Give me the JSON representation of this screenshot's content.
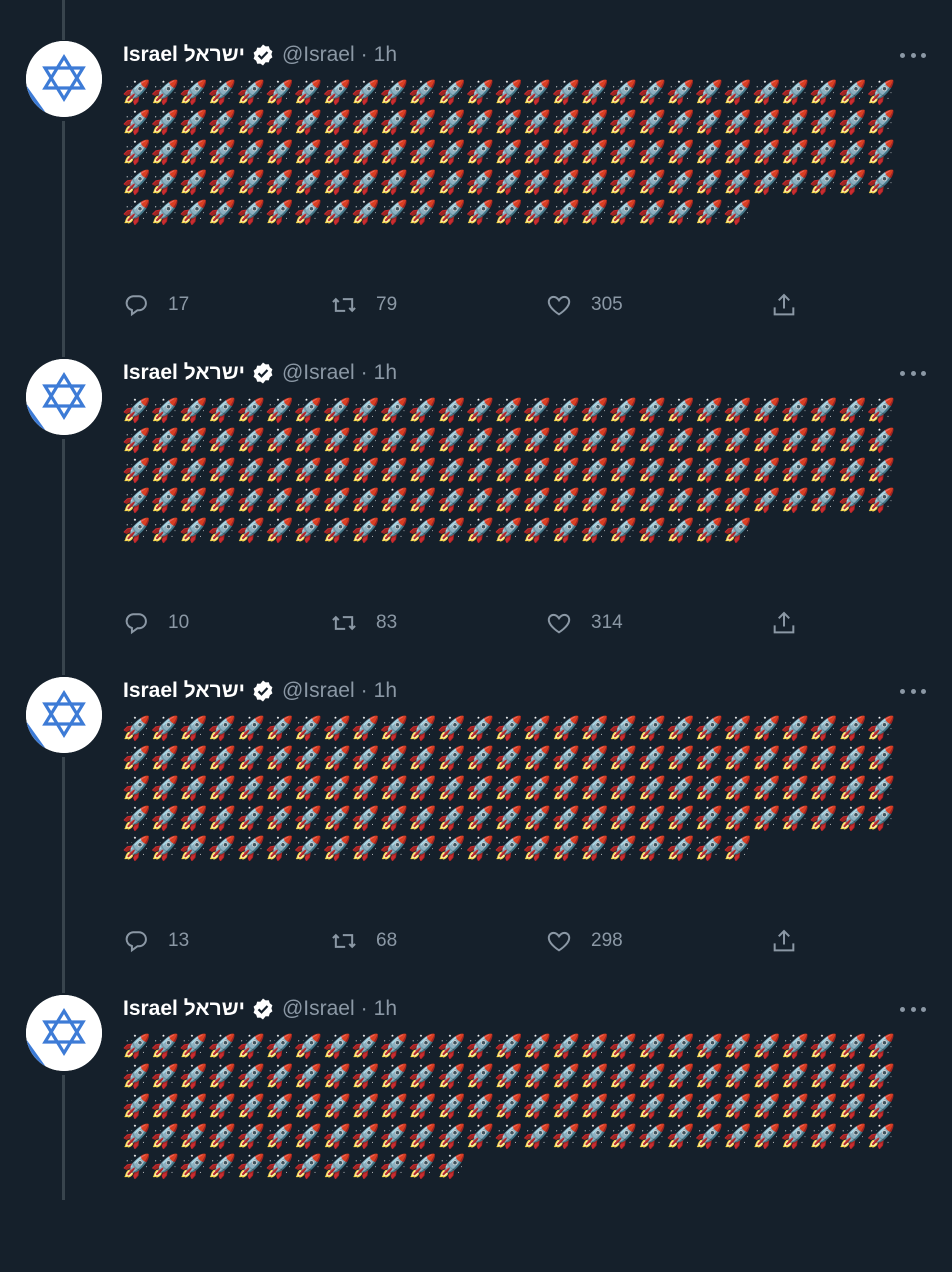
{
  "colors": {
    "background": "#15202b",
    "text_primary": "#ffffff",
    "text_secondary": "#8b98a5",
    "thread_line": "#38444d",
    "verified_badge": "#ffffff",
    "flag_blue": "#3d7bd6"
  },
  "icons": {
    "avatar": "israel-flag-avatar",
    "verified": "verified-badge-icon",
    "more": "more-options-icon",
    "reply": "reply-icon",
    "retweet": "retweet-icon",
    "like": "like-icon",
    "share": "share-icon"
  },
  "tweets": [
    {
      "display_name": "Israel ישראל",
      "handle": "@Israel",
      "separator": "·",
      "time": "1h",
      "text": "🚀🚀🚀🚀🚀🚀🚀🚀🚀🚀🚀🚀🚀🚀🚀🚀🚀🚀🚀🚀🚀🚀🚀🚀🚀🚀🚀🚀🚀🚀🚀🚀🚀🚀🚀🚀🚀🚀🚀🚀🚀🚀🚀🚀🚀🚀🚀🚀🚀🚀🚀🚀🚀🚀🚀🚀🚀🚀🚀🚀🚀🚀🚀🚀🚀🚀🚀🚀🚀🚀🚀🚀🚀🚀🚀🚀🚀🚀🚀🚀🚀🚀🚀🚀🚀🚀🚀🚀🚀🚀🚀🚀🚀🚀🚀🚀🚀🚀🚀🚀🚀🚀🚀🚀🚀🚀🚀🚀🚀🚀🚀🚀🚀🚀🚀🚀🚀🚀🚀🚀🚀🚀🚀🚀🚀🚀🚀🚀🚀🚀",
      "replies": "17",
      "retweets": "79",
      "likes": "305"
    },
    {
      "display_name": "Israel ישראל",
      "handle": "@Israel",
      "separator": "·",
      "time": "1h",
      "text": "🚀🚀🚀🚀🚀🚀🚀🚀🚀🚀🚀🚀🚀🚀🚀🚀🚀🚀🚀🚀🚀🚀🚀🚀🚀🚀🚀🚀🚀🚀🚀🚀🚀🚀🚀🚀🚀🚀🚀🚀🚀🚀🚀🚀🚀🚀🚀🚀🚀🚀🚀🚀🚀🚀🚀🚀🚀🚀🚀🚀🚀🚀🚀🚀🚀🚀🚀🚀🚀🚀🚀🚀🚀🚀🚀🚀🚀🚀🚀🚀🚀🚀🚀🚀🚀🚀🚀🚀🚀🚀🚀🚀🚀🚀🚀🚀🚀🚀🚀🚀🚀🚀🚀🚀🚀🚀🚀🚀🚀🚀🚀🚀🚀🚀🚀🚀🚀🚀🚀🚀🚀🚀🚀🚀🚀🚀🚀🚀🚀🚀",
      "replies": "10",
      "retweets": "83",
      "likes": "314"
    },
    {
      "display_name": "Israel ישראל",
      "handle": "@Israel",
      "separator": "·",
      "time": "1h",
      "text": "🚀🚀🚀🚀🚀🚀🚀🚀🚀🚀🚀🚀🚀🚀🚀🚀🚀🚀🚀🚀🚀🚀🚀🚀🚀🚀🚀🚀🚀🚀🚀🚀🚀🚀🚀🚀🚀🚀🚀🚀🚀🚀🚀🚀🚀🚀🚀🚀🚀🚀🚀🚀🚀🚀🚀🚀🚀🚀🚀🚀🚀🚀🚀🚀🚀🚀🚀🚀🚀🚀🚀🚀🚀🚀🚀🚀🚀🚀🚀🚀🚀🚀🚀🚀🚀🚀🚀🚀🚀🚀🚀🚀🚀🚀🚀🚀🚀🚀🚀🚀🚀🚀🚀🚀🚀🚀🚀🚀🚀🚀🚀🚀🚀🚀🚀🚀🚀🚀🚀🚀🚀🚀🚀🚀🚀🚀🚀🚀🚀🚀",
      "replies": "13",
      "retweets": "68",
      "likes": "298"
    },
    {
      "display_name": "Israel ישראל",
      "handle": "@Israel",
      "separator": "·",
      "time": "1h",
      "text": "🚀🚀🚀🚀🚀🚀🚀🚀🚀🚀🚀🚀🚀🚀🚀🚀🚀🚀🚀🚀🚀🚀🚀🚀🚀🚀🚀🚀🚀🚀🚀🚀🚀🚀🚀🚀🚀🚀🚀🚀🚀🚀🚀🚀🚀🚀🚀🚀🚀🚀🚀🚀🚀🚀🚀🚀🚀🚀🚀🚀🚀🚀🚀🚀🚀🚀🚀🚀🚀🚀🚀🚀🚀🚀🚀🚀🚀🚀🚀🚀🚀🚀🚀🚀🚀🚀🚀🚀🚀🚀🚀🚀🚀🚀🚀🚀🚀🚀🚀🚀🚀🚀🚀🚀🚀🚀🚀🚀🚀🚀🚀🚀🚀🚀🚀🚀🚀🚀🚀🚀",
      "replies": "",
      "retweets": "",
      "likes": ""
    }
  ]
}
